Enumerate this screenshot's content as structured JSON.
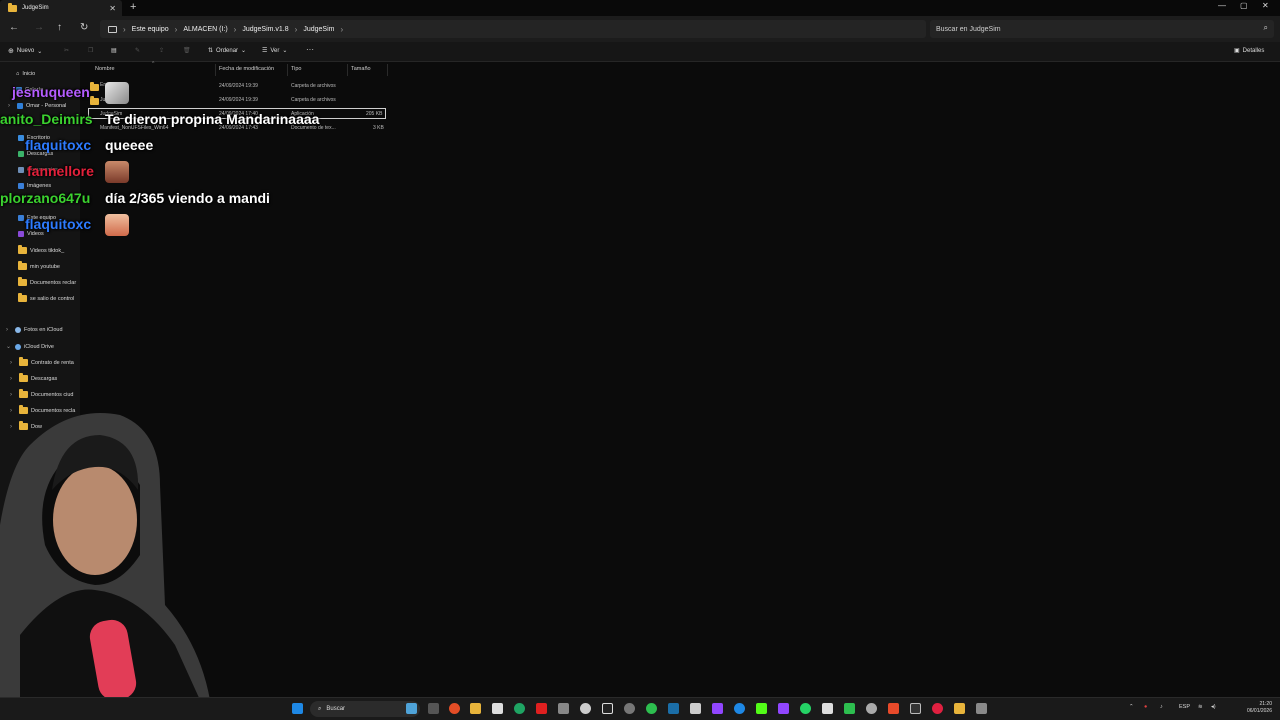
{
  "window": {
    "tab_title": "JudgeSim",
    "close_glyph": "✕",
    "new_tab_glyph": "+",
    "controls": [
      "—",
      "▢",
      "✕"
    ]
  },
  "address": {
    "crumbs": [
      "Este equipo",
      "ALMACEN (I:)",
      "JudgeSim.v1.8",
      "JudgeSim"
    ],
    "separator": "›",
    "search_placeholder": "Buscar en JudgeSim"
  },
  "toolbar": {
    "new_label": "Nuevo",
    "sort_label": "Ordenar",
    "view_label": "Ver",
    "more_glyph": "···",
    "details_label": "Detalles"
  },
  "sidebar": {
    "home": "Inicio",
    "gallery": "Galería",
    "user": "Omar - Personal",
    "quick": [
      "Escritorio",
      "Descargas",
      "Documentos",
      "Imágenes",
      "Este equipo",
      "Videos",
      "Videos tiktok_",
      "min youtube",
      "Documentos reclar",
      "se salio de control"
    ],
    "icloud_photos": "Fotos en iCloud",
    "icloud_drive": "iCloud Drive",
    "icloud_items": [
      "Contrato de renta",
      "Descargas",
      "Documentos ciud",
      "Documentos recla",
      "Dow"
    ]
  },
  "columns": {
    "name": "Nombre",
    "modified": "Fecha de modificación",
    "type": "Tipo",
    "size": "Tamaño"
  },
  "files": [
    {
      "name": "En",
      "modified": "24/09/2024 19:39",
      "type": "Carpeta de archivos",
      "size": ""
    },
    {
      "name": "Jud",
      "modified": "24/09/2024 19:39",
      "type": "Carpeta de archivos",
      "size": ""
    },
    {
      "name": "JudgeSim",
      "modified": "24/09/2024 17:40",
      "type": "Aplicación",
      "size": "205 KB"
    },
    {
      "name": "Manifest_NonUFSFiles_Win64",
      "modified": "24/09/2024 17:43",
      "type": "Documento de tex...",
      "size": "3 KB"
    }
  ],
  "chat": [
    {
      "user": "jesnuqueen",
      "color": "#b45cff",
      "message": ""
    },
    {
      "user": "anito_Deimirs",
      "color": "#3bd12f",
      "message": "Te dieron propina Mandarinaaaa"
    },
    {
      "user": "flaquitoxc",
      "color": "#2d7bff",
      "message": "queeee"
    },
    {
      "user": "fannellore",
      "color": "#e3213b",
      "message": ""
    },
    {
      "user": "plorzano647u",
      "color": "#3bd12f",
      "message": "día 2/365 viendo a mandi"
    },
    {
      "user": "flaquitoxc",
      "color": "#2d7bff",
      "message": ""
    }
  ],
  "taskbar": {
    "search_label": "Buscar",
    "lang": "ESP",
    "time": "21:20",
    "date": "06/01/2026"
  }
}
